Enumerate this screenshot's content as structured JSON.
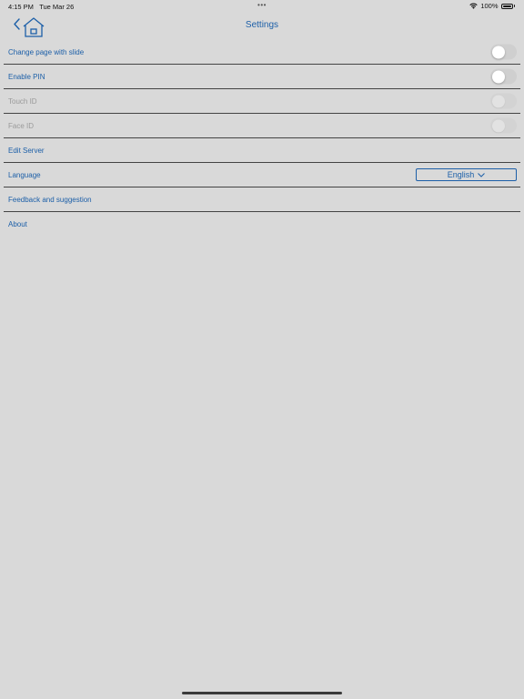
{
  "status_bar": {
    "time": "4:15 PM",
    "date": "Tue Mar 26",
    "battery_text": "100%",
    "battery_level": 1.0,
    "wifi_icon": "wifi-icon",
    "battery_icon": "battery-icon"
  },
  "nav": {
    "title": "Settings",
    "back_icon": "chevron-left-icon",
    "home_icon": "home-icon"
  },
  "settings": {
    "change_page_with_slide": {
      "label": "Change page with slide",
      "enabled": false
    },
    "enable_pin": {
      "label": "Enable PIN",
      "enabled": false
    },
    "touch_id": {
      "label": "Touch ID",
      "enabled": false,
      "disabled": true
    },
    "face_id": {
      "label": "Face ID",
      "enabled": false,
      "disabled": true
    },
    "edit_server": {
      "label": "Edit Server"
    },
    "language": {
      "label": "Language",
      "value": "English"
    },
    "feedback": {
      "label": "Feedback and suggestion"
    },
    "about": {
      "label": "About"
    }
  },
  "colors": {
    "background": "#d9d9d9",
    "accent": "#1c5fa8",
    "disabled_text": "#9a9a9a",
    "divider": "#444444"
  }
}
